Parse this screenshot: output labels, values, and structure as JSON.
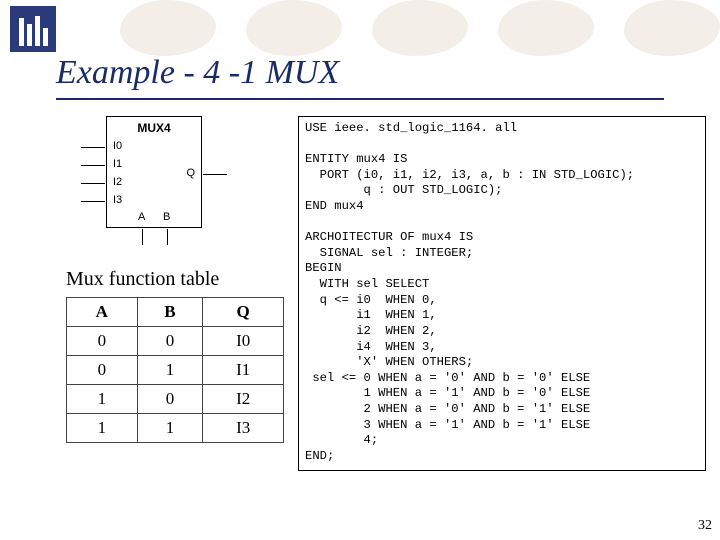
{
  "title": "Example - 4 -1 MUX",
  "mux": {
    "name": "MUX4",
    "inputs": [
      "I0",
      "I1",
      "I2",
      "I3"
    ],
    "output": "Q",
    "selects": [
      "A",
      "B"
    ]
  },
  "caption": "Mux function table",
  "table": {
    "headers": [
      "A",
      "B",
      "Q"
    ],
    "rows": [
      [
        "0",
        "0",
        "I0"
      ],
      [
        "0",
        "1",
        "I1"
      ],
      [
        "1",
        "0",
        "I2"
      ],
      [
        "1",
        "1",
        "I3"
      ]
    ]
  },
  "code": {
    "l1": "USE ieee. std_logic_1164. all",
    "l2": "ENTITY mux4 IS",
    "l3": "  PORT (i0, i1, i2, i3, a, b : IN STD_LOGIC);",
    "l4": "        q : OUT STD_LOGIC);",
    "l5": "END mux4",
    "l6": "ARCHOITECTUR OF mux4 IS",
    "l7": "  SIGNAL sel : INTEGER;",
    "l8": "BEGIN",
    "l9": "  WITH sel SELECT",
    "l10": "  q <= i0  WHEN 0,",
    "l11": "       i1  WHEN 1,",
    "l12": "       i2  WHEN 2,",
    "l13": "       i4  WHEN 3,",
    "l14": "       'X' WHEN OTHERS;",
    "l15": " sel <= 0 WHEN a = '0' AND b = '0' ELSE",
    "l16": "        1 WHEN a = '1' AND b = '0' ELSE",
    "l17": "        2 WHEN a = '0' AND b = '1' ELSE",
    "l18": "        3 WHEN a = '1' AND b = '1' ELSE",
    "l19": "        4;",
    "l20": "END;"
  },
  "page": "32"
}
